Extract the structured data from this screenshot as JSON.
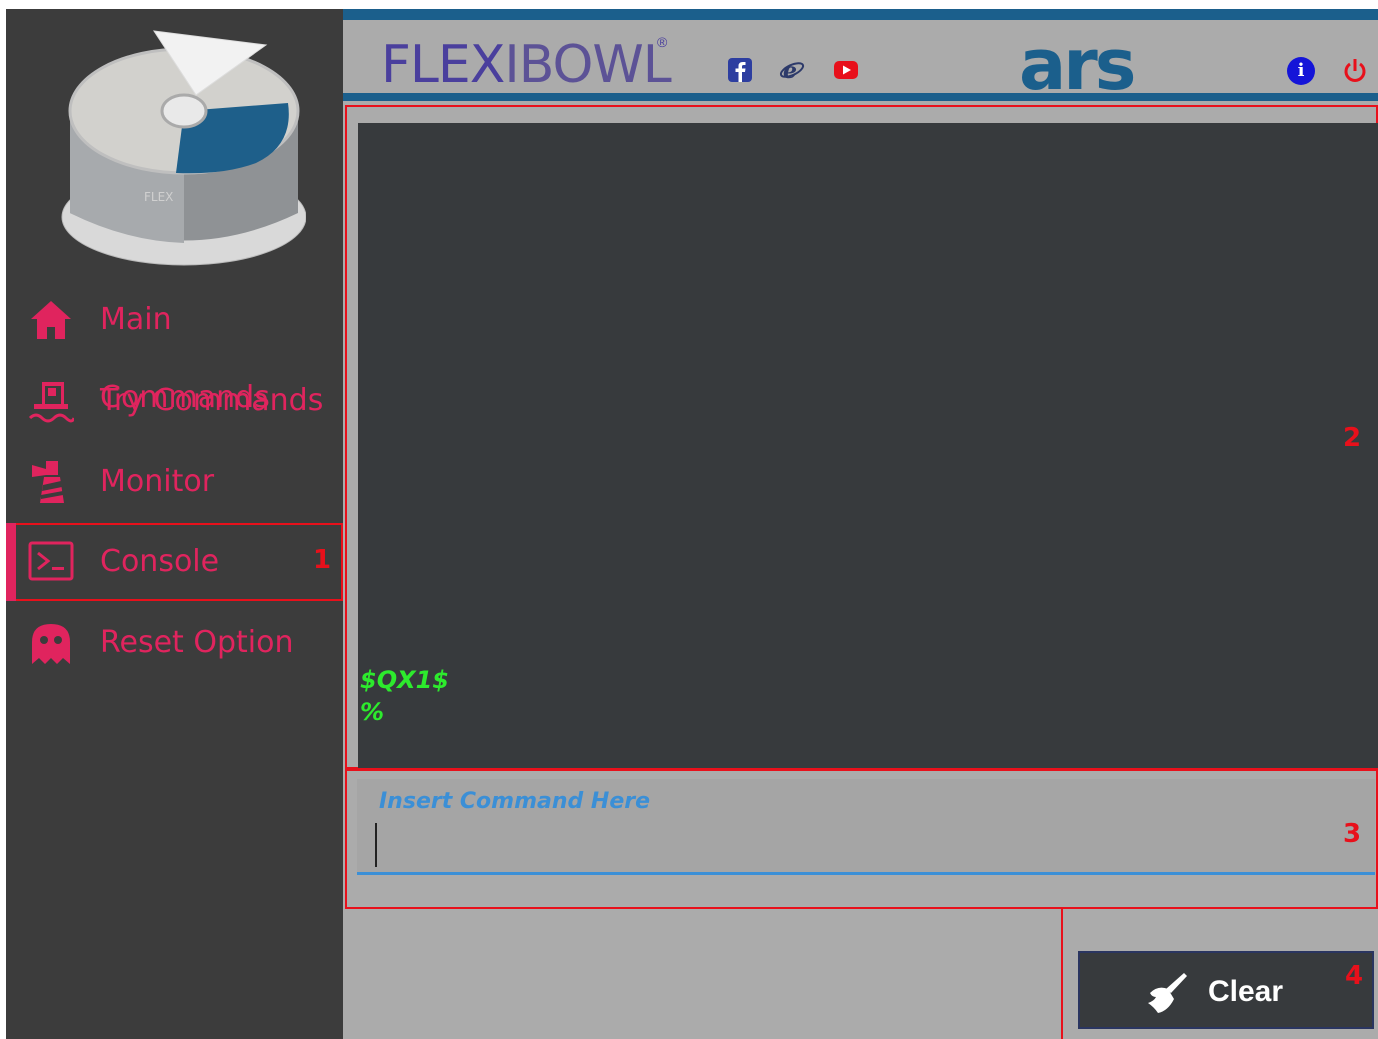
{
  "sidebar": {
    "items": [
      {
        "label": "Main Commands",
        "icon": "home-icon"
      },
      {
        "label": "Try Commands",
        "icon": "oil-rig-icon"
      },
      {
        "label": "Monitor",
        "icon": "lighthouse-icon"
      },
      {
        "label": "Console",
        "icon": "terminal-icon",
        "active": true
      },
      {
        "label": "Reset Option",
        "icon": "ghost-icon"
      }
    ]
  },
  "header": {
    "brand_bold": "FLEX",
    "brand_light": "IBOWL",
    "brand_reg": "®",
    "social": [
      "facebook-icon",
      "internet-explorer-icon",
      "youtube-icon"
    ],
    "ars_logo": "ars",
    "info_symbol": "i"
  },
  "console": {
    "lines": [
      "$QX1$",
      "%"
    ]
  },
  "command_input": {
    "label": "Insert Command Here",
    "value": ""
  },
  "clear_button": {
    "label": "Clear"
  },
  "annotations": [
    "1",
    "2",
    "3",
    "4"
  ],
  "colors": {
    "accent_pink": "#e0245e",
    "annotation_red": "#e8101b",
    "header_blue": "#1b5f8c",
    "console_green": "#2dea2d",
    "input_blue": "#3b8fd6"
  }
}
